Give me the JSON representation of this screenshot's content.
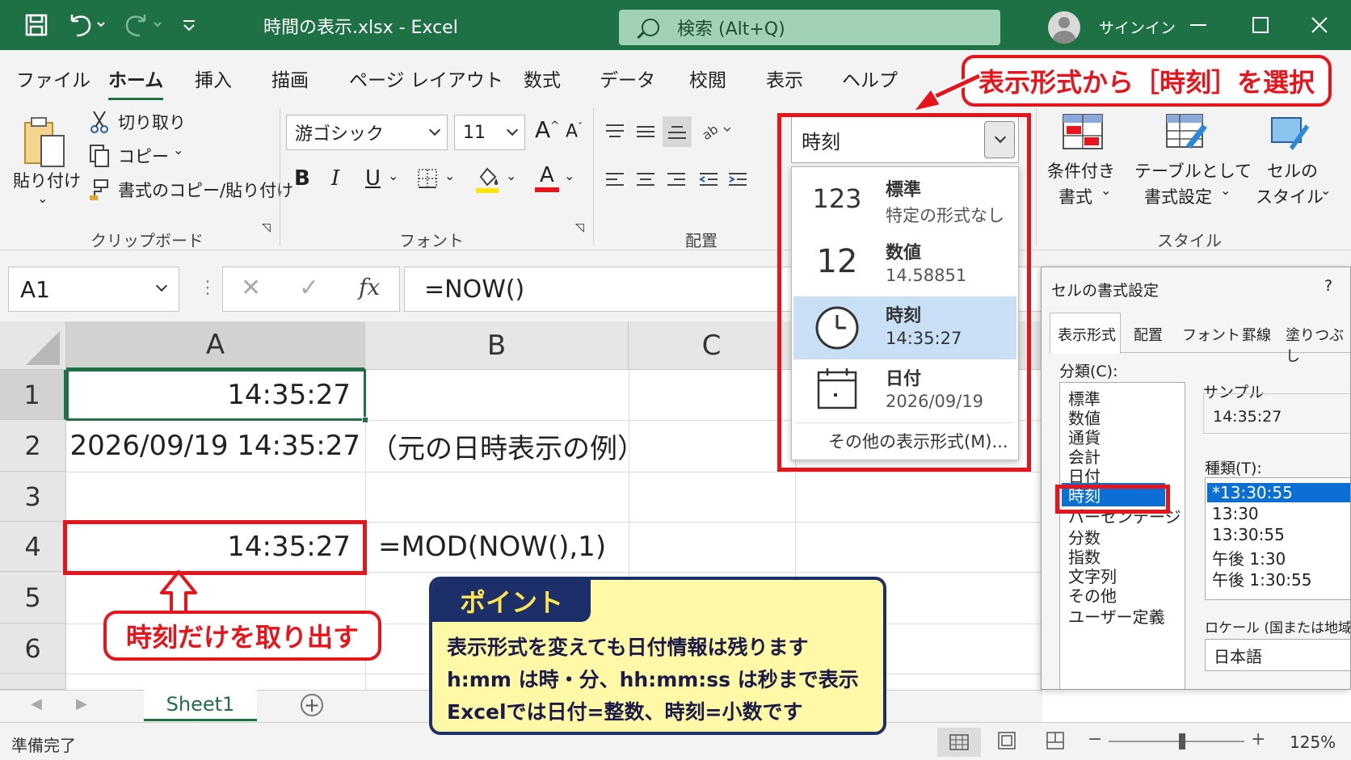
{
  "window": {
    "title": "時間の表示.xlsx  -  Excel",
    "search_placeholder": "検索 (Alt+Q)",
    "signin": "サインイン"
  },
  "ribbon_tabs": [
    "ファイル",
    "ホーム",
    "挿入",
    "描画",
    "ページ レイアウト",
    "数式",
    "データ",
    "校閲",
    "表示",
    "ヘルプ"
  ],
  "clipboard": {
    "paste": "貼り付け",
    "cut": "切り取り",
    "copy": "コピー",
    "format_painter": "書式のコピー/貼り付け",
    "group": "クリップボード"
  },
  "font": {
    "name": "游ゴシック",
    "size": "11",
    "group": "フォント",
    "bold": "B",
    "italic": "I",
    "underline": "U",
    "font_color_letter": "A",
    "grow": "A",
    "shrink": "A"
  },
  "alignment": {
    "group": "配置"
  },
  "number_format": {
    "current": "時刻",
    "options": [
      {
        "icon": "123",
        "name": "標準",
        "sample": "特定の形式なし"
      },
      {
        "icon": "12",
        "name": "数値",
        "sample": "14.58851"
      },
      {
        "icon": "clock-icon",
        "name": "時刻",
        "sample": "14:35:27"
      },
      {
        "icon": "calendar-icon",
        "name": "日付",
        "sample": "2026/09/19"
      }
    ],
    "more": "その他の表示形式(M)..."
  },
  "styles": {
    "conditional": [
      "条件付き",
      "書式"
    ],
    "table": [
      "テーブルとして",
      "書式設定"
    ],
    "cell": [
      "セルの",
      "スタイル"
    ],
    "group": "スタイル"
  },
  "formula_bar": {
    "name_box": "A1",
    "formula": "=NOW()",
    "fx": "fx"
  },
  "grid": {
    "columns": [
      "A",
      "B",
      "C"
    ],
    "rows": [
      "1",
      "2",
      "3",
      "4",
      "5",
      "6"
    ],
    "cells": {
      "A1": "14:35:27",
      "A2": "2026/09/19 14:35:27",
      "B2": "（元の日時表示の例）",
      "A4": "14:35:27",
      "B4": "=MOD(NOW(),1)"
    }
  },
  "sheet_tab": "Sheet1",
  "status": {
    "ready": "準備完了",
    "zoom": "125%",
    "zoom_value": 125
  },
  "dialog": {
    "title": "セルの書式設定",
    "help": "?",
    "tabs": [
      "表示形式",
      "配置",
      "フォント",
      "罫線",
      "塗りつぶし"
    ],
    "category_label": "分類(C):",
    "categories": [
      "標準",
      "数値",
      "通貨",
      "会計",
      "日付",
      "時刻",
      "パーセンテージ",
      "分数",
      "指数",
      "文字列",
      "その他",
      "ユーザー定義"
    ],
    "selected_category": "時刻",
    "sample_label": "サンプル",
    "sample_value": "14:35:27",
    "type_label": "種類(T):",
    "types": [
      "*13:30:55",
      "13:30",
      "13:30:55",
      "午後 1:30",
      "午後 1:30:55"
    ],
    "locale_label": "ロケール (国または地域)(L):",
    "locale": "日本語"
  },
  "annotations": {
    "top_callout": "表示形式から［時刻］を選択",
    "left_callout": "時刻だけを取り出す",
    "point_title": "ポイント",
    "point_lines": [
      "表示形式を変えても日付情報は残ります",
      "h:mm は時・分、hh:mm:ss は秒まで表示",
      "Excelでは日付=整数、時刻=小数です"
    ]
  },
  "colors": {
    "excel_green": "#1e7145",
    "highlight_red": "#e8141c",
    "point_navy": "#1d2f6b",
    "point_yellow": "#fff8a6"
  }
}
